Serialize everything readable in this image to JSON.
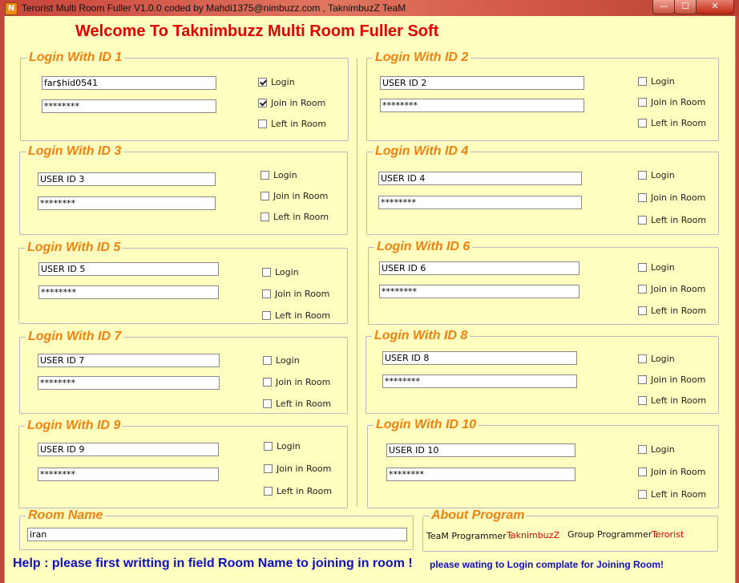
{
  "window": {
    "title": "Terorist Multi Room Fuller V1.0.0 coded by Mahdi1375@nimbuzz.com , TaknimbuzZ TeaM",
    "icon_letter": "N",
    "min_glyph": "—",
    "max_glyph": "☐",
    "close_glyph": "✕"
  },
  "welcome": "Welcome To Taknimbuzz Multi Room Fuller Soft",
  "checkbox_labels": {
    "login": "Login",
    "join": "Join in Room",
    "left": "Left in Room"
  },
  "logins": [
    {
      "title": "Login With ID 1",
      "user": "far$hid0541",
      "password": "********",
      "login": true,
      "join": true,
      "left": false
    },
    {
      "title": "Login With ID 2",
      "user": "USER ID 2",
      "password": "********",
      "login": false,
      "join": false,
      "left": false
    },
    {
      "title": "Login With ID 3",
      "user": "USER ID 3",
      "password": "********",
      "login": false,
      "join": false,
      "left": false
    },
    {
      "title": "Login With ID 4",
      "user": "USER ID 4",
      "password": "********",
      "login": false,
      "join": false,
      "left": false
    },
    {
      "title": "Login With ID 5",
      "user": "USER ID 5",
      "password": "********",
      "login": false,
      "join": false,
      "left": false
    },
    {
      "title": "Login With ID 6",
      "user": "USER ID 6",
      "password": "********",
      "login": false,
      "join": false,
      "left": false
    },
    {
      "title": "Login With ID 7",
      "user": "USER ID 7",
      "password": "********",
      "login": false,
      "join": false,
      "left": false
    },
    {
      "title": "Login With ID 8",
      "user": "USER ID 8",
      "password": "********",
      "login": false,
      "join": false,
      "left": false
    },
    {
      "title": "Login With ID 9",
      "user": "USER ID 9",
      "password": "********",
      "login": false,
      "join": false,
      "left": false
    },
    {
      "title": "Login With ID 10",
      "user": "USER ID 10",
      "password": "********",
      "login": false,
      "join": false,
      "left": false
    }
  ],
  "room": {
    "title": "Room Name",
    "value": "iran"
  },
  "about": {
    "title": "About Program",
    "team_label": "TeaM Programmer :",
    "team_value": "TaknimbuzZ",
    "group_label": "Group Programmer :",
    "group_value": "Terorist"
  },
  "help": "Help : please first writting in field Room Name to joining in room !",
  "status": "please wating to Login complate for Joining Room!"
}
